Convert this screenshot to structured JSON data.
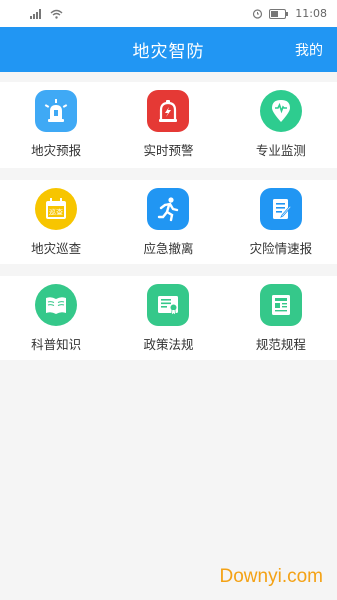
{
  "statusbar": {
    "time": "11:08",
    "left_icons": [
      "signal-icon",
      "wifi-icon"
    ],
    "right_icons": [
      "alarm-icon",
      "battery-icon"
    ]
  },
  "appbar": {
    "title": "地灾智防",
    "right_action": "我的",
    "color": "#2196f3"
  },
  "sections": [
    {
      "items": [
        {
          "label": "地灾预报",
          "icon": "siren-icon",
          "color": "#3fa9f5"
        },
        {
          "label": "实时预警",
          "icon": "alarm-bell-icon",
          "color": "#e53935"
        },
        {
          "label": "专业监测",
          "icon": "location-pulse-icon",
          "color": "#2ecc8f"
        }
      ]
    },
    {
      "items": [
        {
          "label": "地灾巡查",
          "icon": "patrol-calendar-icon",
          "color": "#f7c500"
        },
        {
          "label": "应急撤离",
          "icon": "running-person-icon",
          "color": "#2196f3"
        },
        {
          "label": "灾险情速报",
          "icon": "report-edit-icon",
          "color": "#2196f3"
        }
      ]
    },
    {
      "items": [
        {
          "label": "科普知识",
          "icon": "open-book-icon",
          "color": "#35c88a"
        },
        {
          "label": "政策法规",
          "icon": "certificate-icon",
          "color": "#35c88a"
        },
        {
          "label": "规范规程",
          "icon": "newspaper-icon",
          "color": "#35c88a"
        }
      ]
    }
  ],
  "patrol_badge_text": "巡查",
  "watermark": "Downyi.com"
}
